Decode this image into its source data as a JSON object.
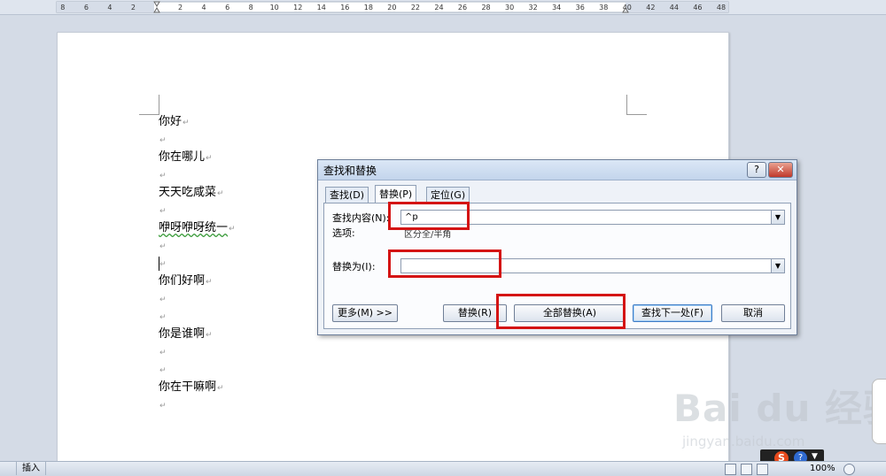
{
  "ruler": {
    "left_ticks": [
      "8",
      "6",
      "4",
      "2"
    ],
    "right_ticks": [
      "2",
      "4",
      "6",
      "8",
      "10",
      "12",
      "14",
      "16",
      "18",
      "20",
      "22",
      "24",
      "26",
      "28",
      "30",
      "32",
      "34",
      "36",
      "38",
      "40",
      "42",
      "44",
      "46",
      "48"
    ]
  },
  "document": {
    "lines": [
      {
        "text": "你好"
      },
      {
        "text": ""
      },
      {
        "text": "你在哪儿"
      },
      {
        "text": ""
      },
      {
        "text": "天天吃咸菜"
      },
      {
        "text": ""
      },
      {
        "text": "咿呀咿呀统一"
      },
      {
        "text": ""
      },
      {
        "text": ""
      },
      {
        "text": "你们好啊"
      },
      {
        "text": ""
      },
      {
        "text": ""
      },
      {
        "text": "你是谁啊"
      },
      {
        "text": ""
      },
      {
        "text": ""
      },
      {
        "text": "你在干嘛啊"
      },
      {
        "text": ""
      }
    ],
    "paragraph_mark": "↵"
  },
  "dialog": {
    "title": "查找和替换",
    "help_label": "?",
    "close_label": "✕",
    "tabs": [
      {
        "label": "查找(D)",
        "active": false
      },
      {
        "label": "替换(P)",
        "active": true
      },
      {
        "label": "定位(G)",
        "active": false
      }
    ],
    "find_label": "查找内容(N):",
    "find_value": "^p",
    "options_label": "选项:",
    "options_value": "区分全/半角",
    "replace_label": "替换为(I):",
    "replace_value": "",
    "dropdown_arrow": "▼",
    "buttons": {
      "more": "更多(M) >>",
      "replace": "替换(R)",
      "replace_all": "全部替换(A)",
      "find_next": "查找下一处(F)",
      "cancel": "取消"
    }
  },
  "statusbar": {
    "mode": "插入",
    "zoom": "100%"
  },
  "ime": {
    "logo": "S",
    "help": "?",
    "arrow": "▼"
  },
  "watermark": {
    "brand": "Bai du 经验",
    "url": "jingyan.baidu.com"
  },
  "colors": {
    "highlight": "#d41414",
    "page": "#ffffff",
    "background": "#d4dbe6"
  }
}
